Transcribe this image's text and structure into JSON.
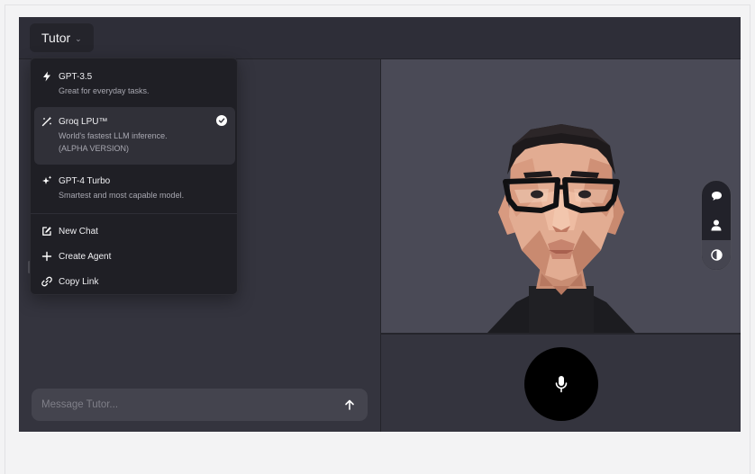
{
  "header": {
    "agent_name": "Tutor"
  },
  "model_menu": {
    "options": [
      {
        "title": "GPT-3.5",
        "description": "Great for everyday tasks.",
        "icon": "lightning-icon",
        "selected": false
      },
      {
        "title": "Groq LPU™",
        "description": "World's fastest LLM inference.",
        "description_2": "(ALPHA VERSION)",
        "icon": "magic-wand-icon",
        "selected": true
      },
      {
        "title": "GPT-4 Turbo",
        "description": "Smartest and most capable model.",
        "icon": "sparkles-icon",
        "selected": false
      }
    ],
    "actions": [
      {
        "label": "New Chat",
        "icon": "edit-icon"
      },
      {
        "label": "Create Agent",
        "icon": "plus-icon"
      },
      {
        "label": "Copy Link",
        "icon": "link-icon"
      }
    ]
  },
  "composer": {
    "placeholder": "Message Tutor...",
    "value": ""
  },
  "side_controls": [
    {
      "name": "chat-bubble-icon",
      "active": false
    },
    {
      "name": "person-icon",
      "active": false
    },
    {
      "name": "contrast-icon",
      "active": true
    }
  ],
  "colors": {
    "background": "#f3f3f4",
    "app_bg": "#34343e",
    "avatar_bg": "#4a4a56",
    "menu_bg": "#1f1f25",
    "mic_button": "#000000"
  }
}
